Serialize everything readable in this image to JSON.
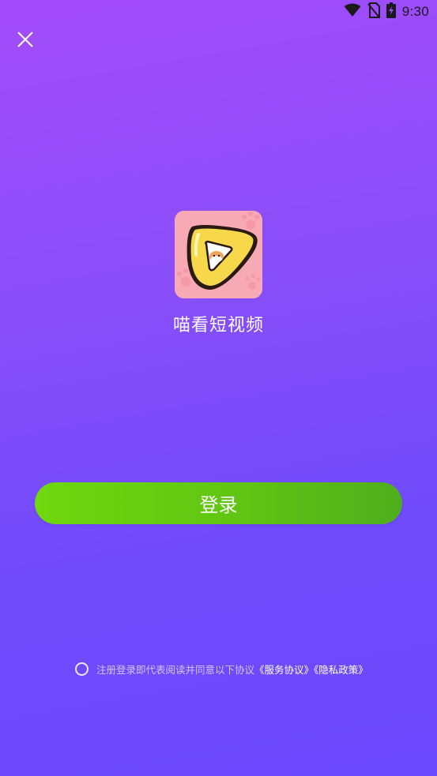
{
  "status_bar": {
    "time": "9:30",
    "icons": [
      "wifi-icon",
      "no-sim-icon",
      "battery-charging-icon"
    ]
  },
  "header": {
    "close_icon": "close-icon"
  },
  "app": {
    "name": "喵看短视频",
    "icon": "app-logo-icon"
  },
  "login": {
    "button_label": "登录",
    "button_color": "#6fd80e"
  },
  "agreement": {
    "text": "注册登录即代表阅读并同意以下协议",
    "service_link": "《服务协议》",
    "privacy_link": "《隐私政策》"
  },
  "colors": {
    "background_top": "#a34bfb",
    "background_bottom": "#6a48fd",
    "accent_green": "#5fc313"
  }
}
